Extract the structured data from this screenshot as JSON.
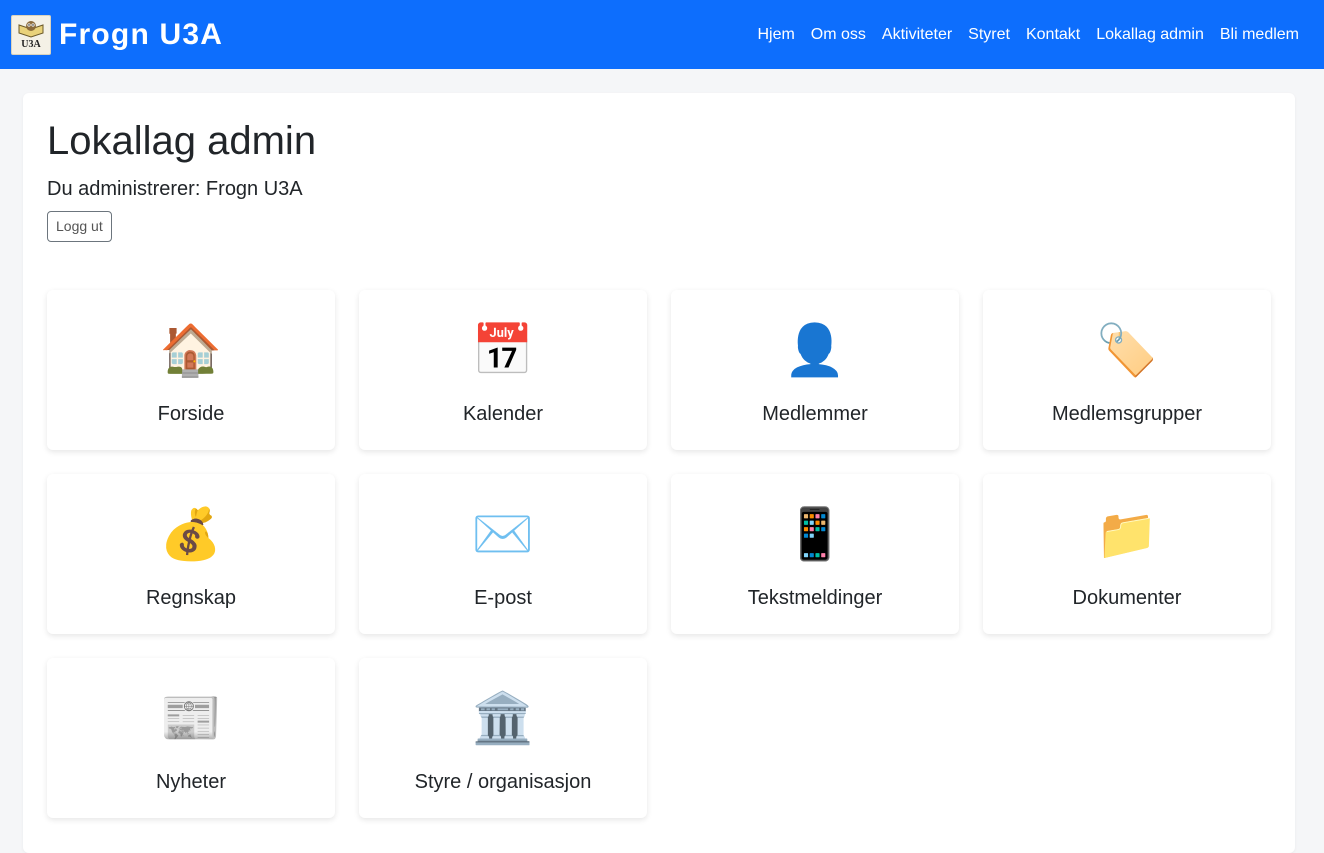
{
  "header": {
    "logo_text": "U3A",
    "brand": "Frogn U3A",
    "nav": [
      "Hjem",
      "Om oss",
      "Aktiviteter",
      "Styret",
      "Kontakt",
      "Lokallag admin",
      "Bli medlem"
    ]
  },
  "page": {
    "title": "Lokallag admin",
    "subtitle": "Du administrerer: Frogn U3A",
    "logout_label": "Logg ut"
  },
  "cards": [
    {
      "icon": "house-icon",
      "glyph": "🏠",
      "label": "Forside"
    },
    {
      "icon": "calendar-icon",
      "glyph": "📅",
      "label": "Kalender"
    },
    {
      "icon": "user-icon",
      "glyph": "👤",
      "label": "Medlemmer"
    },
    {
      "icon": "tag-icon",
      "glyph": "🏷️",
      "label": "Medlemsgrupper"
    },
    {
      "icon": "money-bag-icon",
      "glyph": "💰",
      "label": "Regnskap"
    },
    {
      "icon": "envelope-icon",
      "glyph": "✉️",
      "label": "E-post"
    },
    {
      "icon": "phone-icon",
      "glyph": "📱",
      "label": "Tekstmeldinger"
    },
    {
      "icon": "folder-icon",
      "glyph": "📁",
      "label": "Dokumenter"
    },
    {
      "icon": "newspaper-icon",
      "glyph": "📰",
      "label": "Nyheter"
    },
    {
      "icon": "bank-icon",
      "glyph": "🏛️",
      "label": "Styre / organisasjon"
    }
  ]
}
